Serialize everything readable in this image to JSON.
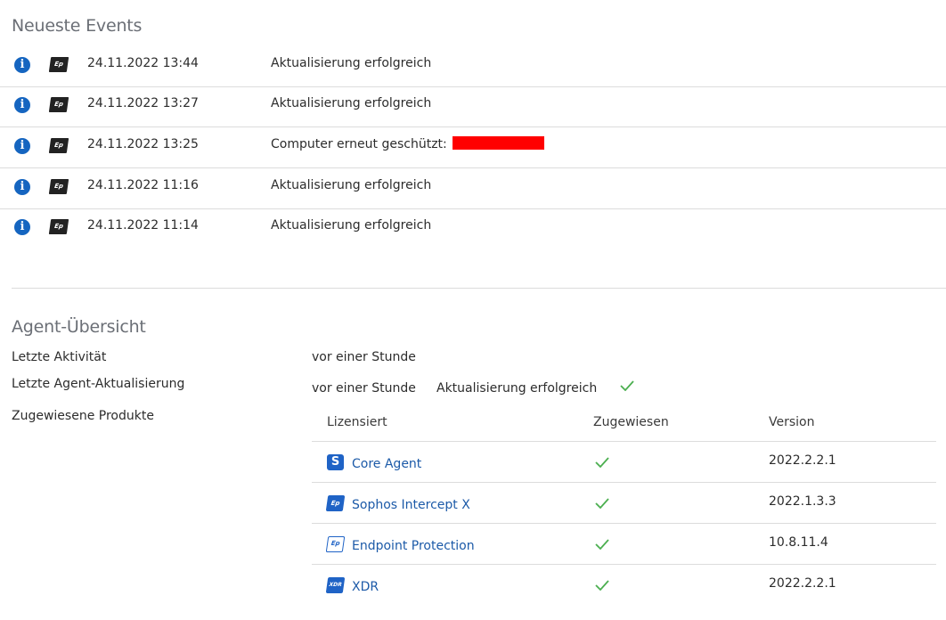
{
  "events": {
    "title": "Neueste Events",
    "rows": [
      {
        "time": "24.11.2022 13:44",
        "message": "Aktualisierung erfolgreich",
        "redacted": false
      },
      {
        "time": "24.11.2022 13:27",
        "message": "Aktualisierung erfolgreich",
        "redacted": false
      },
      {
        "time": "24.11.2022 13:25",
        "message": "Computer erneut geschützt:",
        "redacted": true
      },
      {
        "time": "24.11.2022 11:16",
        "message": "Aktualisierung erfolgreich",
        "redacted": false
      },
      {
        "time": "24.11.2022 11:14",
        "message": "Aktualisierung erfolgreich",
        "redacted": false
      }
    ],
    "info_icon": "i",
    "product_icon": "Ep",
    "redaction_color": "#ff0000"
  },
  "agent": {
    "title": "Agent-Übersicht",
    "last_activity_label": "Letzte Aktivität",
    "last_activity_value": "vor einer Stunde",
    "last_update_label": "Letzte Agent-Aktualisierung",
    "last_update_value": "vor einer Stunde",
    "last_update_status": "Aktualisierung erfolgreich",
    "assigned_label": "Zugewiesene Produkte"
  },
  "products": {
    "headers": {
      "licensed": "Lizensiert",
      "assigned": "Zugewiesen",
      "version": "Version"
    },
    "rows": [
      {
        "icon": "S",
        "icon_style": "solid",
        "name": "Core Agent",
        "version": "2022.2.2.1"
      },
      {
        "icon": "Ep",
        "icon_style": "solid",
        "name": "Sophos Intercept X",
        "version": "2022.1.3.3"
      },
      {
        "icon": "Ep",
        "icon_style": "outline",
        "name": "Endpoint Protection",
        "version": "10.8.11.4"
      },
      {
        "icon": "XDR",
        "icon_style": "solid",
        "name": "XDR",
        "version": "2022.2.2.1"
      }
    ]
  },
  "colors": {
    "link": "#1c5aa8",
    "check": "#4caf50",
    "info": "#1565c0",
    "product_blue": "#1f63c6"
  }
}
